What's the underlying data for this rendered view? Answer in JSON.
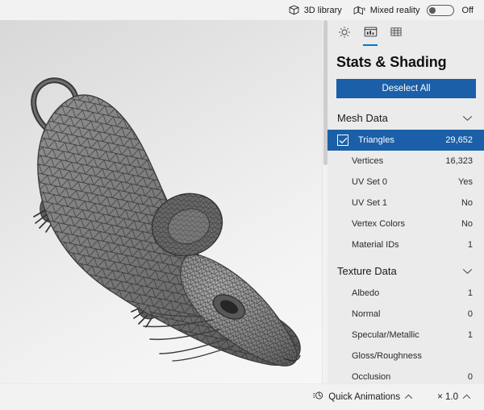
{
  "topbar": {
    "library_label": "3D library",
    "library_icon": "cube-icon",
    "mixed_reality_label": "Mixed reality",
    "mixed_reality_icon": "mixed-reality-icon",
    "mixed_reality_toggle_state": "Off",
    "mixed_reality_toggle_on": false
  },
  "panel": {
    "tabs": [
      {
        "name": "lighting",
        "icon": "sun-icon",
        "active": false
      },
      {
        "name": "stats-shading",
        "icon": "stats-icon",
        "active": true
      },
      {
        "name": "grid",
        "icon": "grid-icon",
        "active": false
      }
    ],
    "title": "Stats & Shading",
    "deselect_label": "Deselect All",
    "accent_color": "#1a5fa8",
    "sections": [
      {
        "name": "mesh-data",
        "title": "Mesh Data",
        "expanded": true,
        "rows": [
          {
            "label": "Triangles",
            "value": "29,652",
            "selected": true,
            "checked": true
          },
          {
            "label": "Vertices",
            "value": "16,323",
            "selected": false,
            "checked": false
          },
          {
            "label": "UV Set 0",
            "value": "Yes",
            "selected": false,
            "checked": false
          },
          {
            "label": "UV Set 1",
            "value": "No",
            "selected": false,
            "checked": false
          },
          {
            "label": "Vertex Colors",
            "value": "No",
            "selected": false,
            "checked": false
          },
          {
            "label": "Material IDs",
            "value": "1",
            "selected": false,
            "checked": false
          }
        ]
      },
      {
        "name": "texture-data",
        "title": "Texture Data",
        "expanded": true,
        "rows": [
          {
            "label": "Albedo",
            "value": "1",
            "selected": false,
            "checked": false
          },
          {
            "label": "Normal",
            "value": "0",
            "selected": false,
            "checked": false
          },
          {
            "label": "Specular/Metallic",
            "value": "1",
            "selected": false,
            "checked": false
          },
          {
            "label": "Gloss/Roughness",
            "value": "",
            "selected": false,
            "checked": false
          },
          {
            "label": "Occlusion",
            "value": "0",
            "selected": false,
            "checked": false
          }
        ]
      }
    ]
  },
  "bottombar": {
    "quick_animations_label": "Quick Animations",
    "quick_animations_icon": "animation-icon",
    "speed_label": "× 1.0"
  },
  "viewport": {
    "name": "3d-model-viewport",
    "model": "wireframe-rodent"
  }
}
